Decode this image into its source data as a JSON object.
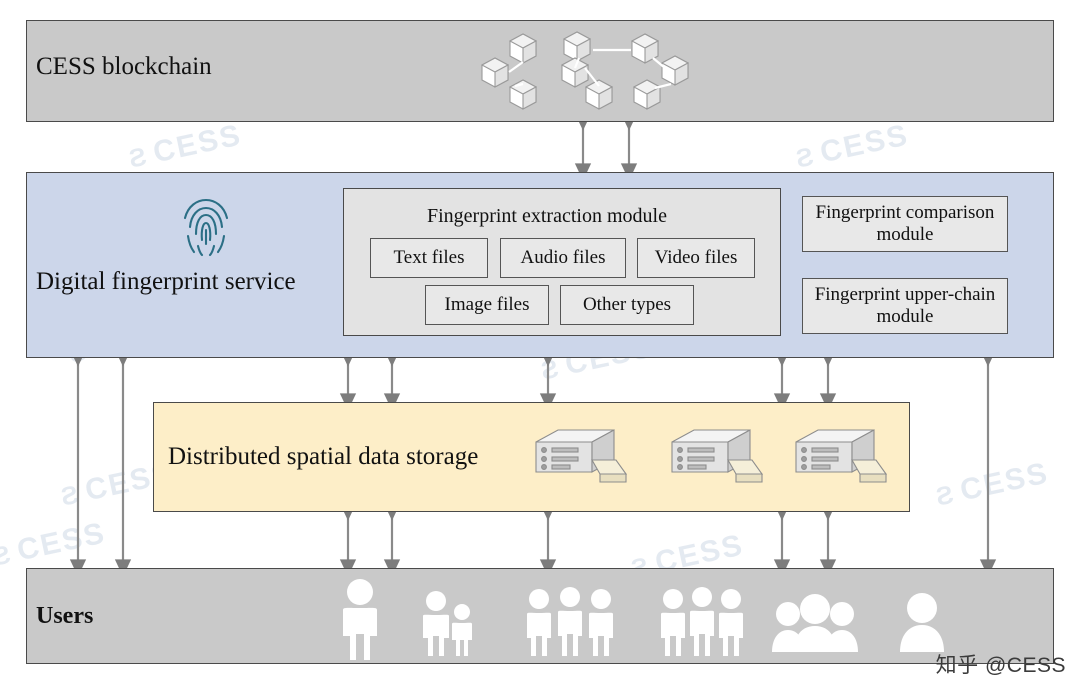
{
  "figure": {
    "credit": "知乎 @CESS",
    "watermark_text": "CESS",
    "watermark_mark": "Ƨ"
  },
  "layers": [
    {
      "id": "blockchain",
      "title": "CESS blockchain",
      "title_bold": false,
      "color": "#c9c9c9",
      "icon": "blockchain-nodes-icon"
    },
    {
      "id": "fingerprint-service",
      "title": "Digital fingerprint service",
      "title_bold": false,
      "color": "#ccd6ea",
      "icon": "fingerprint-icon",
      "groups": [
        {
          "id": "extraction",
          "label": "Fingerprint extraction module",
          "items": [
            "Text files",
            "Audio files",
            "Video files",
            "Image files",
            "Other types"
          ]
        }
      ],
      "modules": [
        "Fingerprint comparison module",
        "Fingerprint upper-chain module"
      ]
    },
    {
      "id": "storage",
      "title": "Distributed spatial data storage",
      "title_bold": false,
      "color": "#fdeec8",
      "icon": "server-icon"
    },
    {
      "id": "users",
      "title": "Users",
      "title_bold": true,
      "color": "#c9c9c9",
      "icon": "people-icon"
    }
  ]
}
